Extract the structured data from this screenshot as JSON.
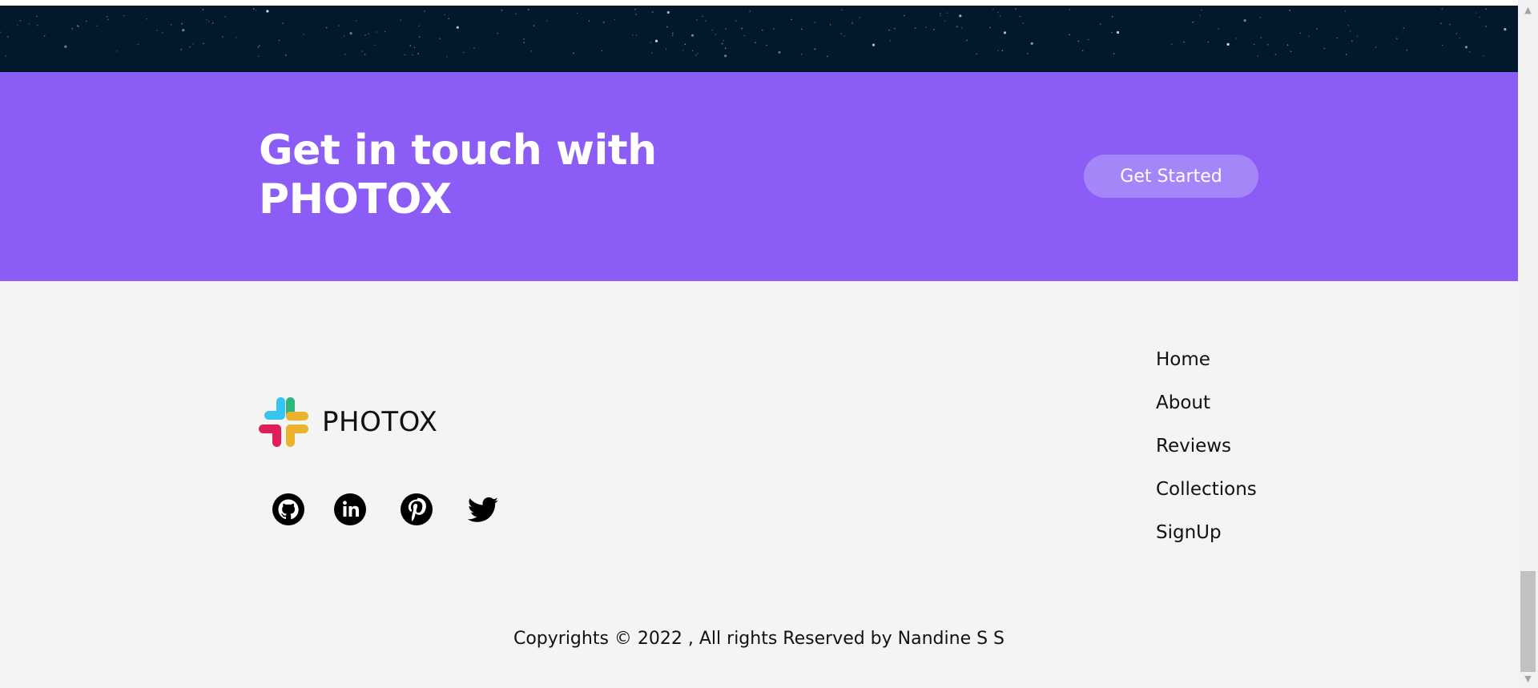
{
  "cta": {
    "title": "Get in touch with\nPHOTOX",
    "button_label": "Get Started"
  },
  "brand": {
    "name": "PHOTOX",
    "logo_icon": "slack-style-logo-icon"
  },
  "social": [
    {
      "name": "github",
      "icon": "github-icon"
    },
    {
      "name": "linkedin",
      "icon": "linkedin-icon"
    },
    {
      "name": "pinterest",
      "icon": "pinterest-icon"
    },
    {
      "name": "twitter",
      "icon": "twitter-icon"
    }
  ],
  "nav": {
    "items": [
      "Home",
      "About",
      "Reviews",
      "Collections",
      "SignUp"
    ]
  },
  "footer": {
    "copyright": "Copyrights © 2022 , All rights Reserved by Nandine S S"
  },
  "colors": {
    "cta_background": "#8b5cf6",
    "button_background": "#a586f8",
    "footer_background": "#f4f4f4",
    "space_background": "#03182b"
  }
}
